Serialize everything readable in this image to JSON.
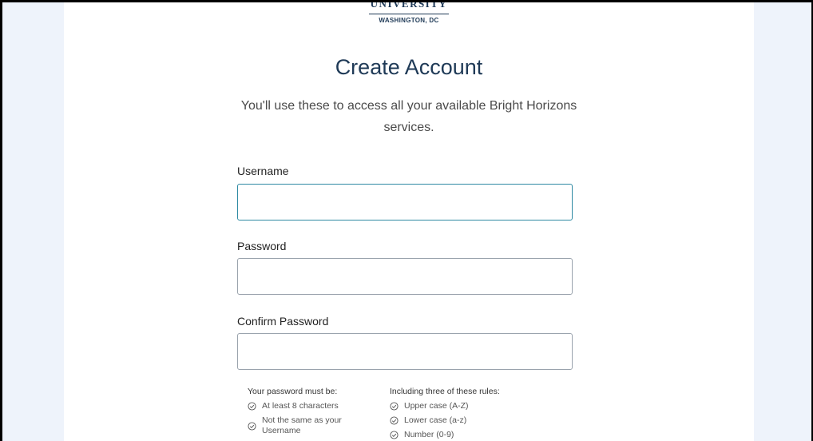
{
  "logo": {
    "name": "UNIVERSITY",
    "location": "WASHINGTON, DC"
  },
  "page": {
    "title": "Create Account",
    "subtitle": "You'll use these to access all your available Bright Horizons services."
  },
  "form": {
    "username_label": "Username",
    "password_label": "Password",
    "confirm_password_label": "Confirm Password"
  },
  "password_rules": {
    "must_be_title": "Your password must be:",
    "must_be": [
      "At least 8 characters",
      "Not the same as your Username"
    ],
    "including_title": "Including three of these rules:",
    "including": [
      "Upper case (A-Z)",
      "Lower case (a-z)",
      "Number (0-9)"
    ]
  },
  "colors": {
    "heading": "#1f3a57",
    "focus_border": "#2f8aa3",
    "page_background": "#eef3fb"
  }
}
